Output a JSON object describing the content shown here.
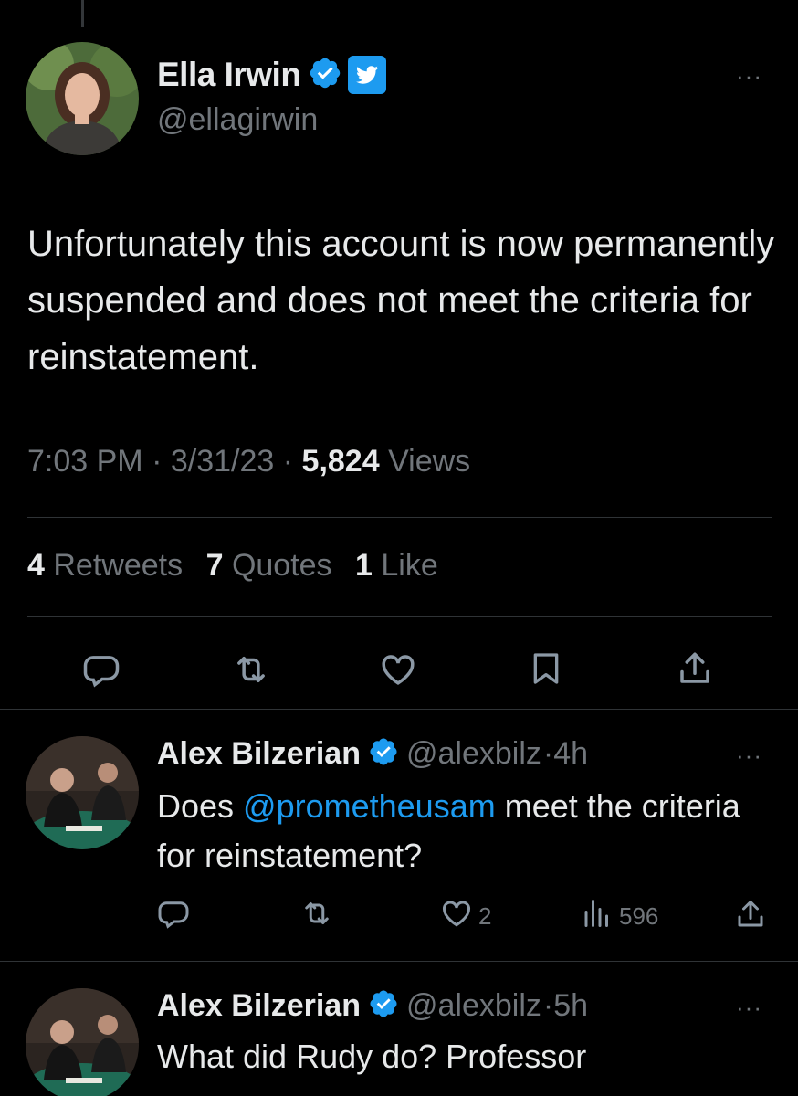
{
  "main_tweet": {
    "display_name": "Ella Irwin",
    "handle": "@ellagirwin",
    "text": "Unfortunately this account is now permanently suspended and does not meet the criteria for reinstatement.",
    "time": "7:03 PM",
    "date": "3/31/23",
    "views_count": "5,824",
    "views_label": "Views",
    "separator": "·",
    "retweets_count": "4",
    "retweets_label": "Retweets",
    "quotes_count": "7",
    "quotes_label": "Quotes",
    "likes_count": "1",
    "likes_label": "Like",
    "more_label": "···"
  },
  "replies": [
    {
      "display_name": "Alex Bilzerian",
      "handle": "@alexbilz",
      "time": "·4h",
      "text_before": "Does ",
      "mention": "@prometheusam",
      "text_after": " meet the criteria for reinstatement?",
      "likes": "2",
      "views": "596",
      "more_label": "···"
    },
    {
      "display_name": "Alex Bilzerian",
      "handle": "@alexbilz",
      "time": "·5h",
      "text": "What did Rudy do? Professor",
      "more_label": "···"
    }
  ],
  "colors": {
    "background": "#000000",
    "text": "#e7e9ea",
    "muted": "#71767b",
    "accent": "#1d9bf0",
    "divider": "#2f3336"
  },
  "icons": [
    "reply-icon",
    "retweet-icon",
    "like-icon",
    "bookmark-icon",
    "share-icon",
    "views-icon",
    "verified-badge-icon",
    "twitter-bird-icon"
  ]
}
